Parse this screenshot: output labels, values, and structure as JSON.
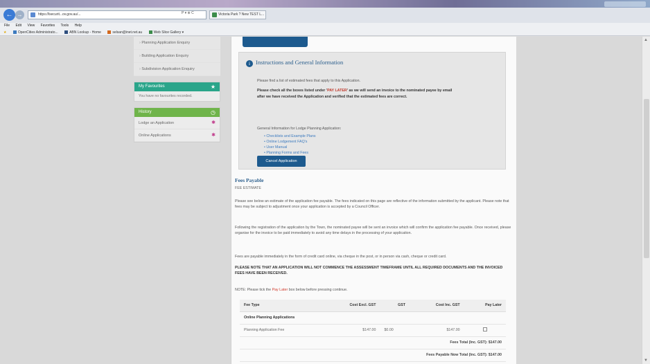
{
  "browser": {
    "url": "https://lsecurit...ov.gov.au/...",
    "url_controls": "P ▾ ⊕ C",
    "tab_title": "Victoria Park ? New TEST L...",
    "menu": [
      "File",
      "Edit",
      "View",
      "Favorites",
      "Tools",
      "Help"
    ],
    "favorites": [
      {
        "label": "OpenCities Administrato...",
        "color": "#3d7bbf"
      },
      {
        "label": "ABN Lookup - Home",
        "color": "#2e4e7e"
      },
      {
        "label": "selsan@inet.net.au",
        "color": "#d2691e"
      },
      {
        "label": "Web Slice Gallery ▾",
        "color": "#3c8c4a"
      }
    ]
  },
  "sidebar": {
    "links": [
      "Planning Application Enquiry",
      "Building Application Enquiry",
      "Subdivision Application Enquiry"
    ],
    "favourites": {
      "title": "My Favourites",
      "icon": "star-icon",
      "empty_text": "You have no favourites recorded.",
      "color": "#2aa58a"
    },
    "history": {
      "title": "History",
      "icon": "clock-icon",
      "color": "#6fb44a",
      "items": [
        "Lodge an Application",
        "Online Applications"
      ]
    }
  },
  "info": {
    "title": "Instructions and General Information",
    "line1": "Please find a list of estimated fees that apply to this Application.",
    "bold1_a": "Please check all the boxes listed under '",
    "bold1_red": "PAY LATER",
    "bold1_b": "' as we will send an invoice to the nominated payee by email",
    "bold2": "after we have received the Application and verified that the estimated fees are correct.",
    "general": "General Information for Lodge Planning Application:",
    "links": [
      "Checklists and Example Plans",
      "Online Lodgement FAQ's",
      "User Manual",
      "Planning Forms and Fees"
    ],
    "cancel_label": "Cancel Application"
  },
  "fees": {
    "title": "Fees Payable",
    "subtitle": "FEE ESTIMATE",
    "p1": "Please see below an estimate of the application fee payable. The fees indicated on this page are reflective of the information submitted by the applicant. Please note that fees may be subject to adjustment once your application is accepted by a Council Officer.",
    "p2": "Following the registration of the application by the Town, the nominated payee will be sent an invoice which will confirm the application fee payable. Once received, please organise for the invoice to be paid immediately to avoid any time delays in the processing of your application.",
    "p3": "Fees are payable immediately in the form of credit card online, via cheque in the post, or in person via cash, cheque or credit card.",
    "p4": "PLEASE NOTE THAT AN APPLICATION WILL NOT COMMENCE THE ASSESSMENT TIMEFRAME UNTIL ALL REQUIRED DOCUMENTS AND THE INVOICED FEES HAVE BEEN RECEIVED.",
    "note_a": "NOTE: Please tick the ",
    "note_red": "Pay Later",
    "note_b": " box below before pressing continue.",
    "headers": [
      "Fee Type",
      "Cost Excl. GST",
      "GST",
      "Cost Inc. GST",
      "Pay Later"
    ],
    "group": "Online Planning Applications",
    "row": {
      "type": "Planning Application Fee",
      "excl": "$147.00",
      "gst": "$0.00",
      "inc": "$147.00"
    },
    "total": "Fees Total (Inc. GST): $147.00",
    "payable_now": "Fees Payable Now Total (Inc. GST): $147.00"
  }
}
